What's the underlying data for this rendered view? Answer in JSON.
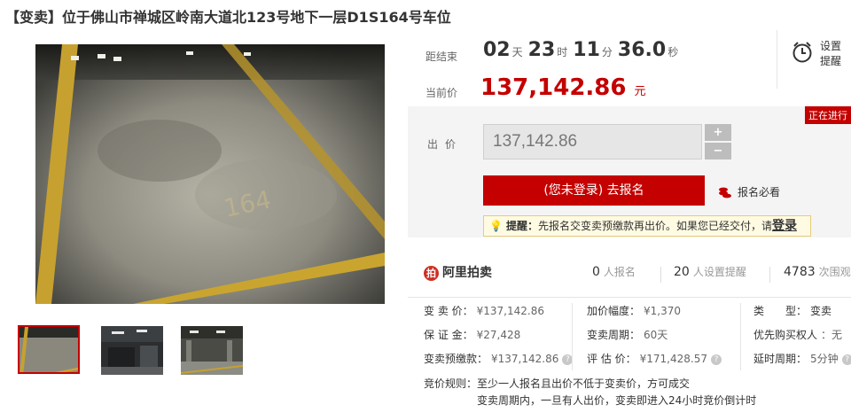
{
  "title": "【变卖】位于佛山市禅城区岭南大道北123号地下一层D1S164号车位",
  "countdown": {
    "label": "距结束",
    "days": "02",
    "days_unit": "天",
    "hours": "23",
    "hours_unit": "时",
    "minutes": "11",
    "minutes_unit": "分",
    "seconds": "36.0",
    "seconds_unit": "秒"
  },
  "reminder": {
    "label": "设置提醒"
  },
  "current_price": {
    "label": "当前价",
    "value": "137,142.86",
    "unit": "元"
  },
  "status_tag": "正在进行",
  "bid": {
    "label": "出价",
    "input_value": "137,142.86",
    "plus": "+",
    "minus": "−",
    "signup_button": "(您未登录) 去报名",
    "must_read": "报名必看"
  },
  "tip": {
    "prefix": "提醒：",
    "text": "先报名交变卖预缴款再出价。如果您已经交付，请",
    "login": "登录"
  },
  "stats": {
    "logo": "阿里拍卖",
    "signups_count": "0",
    "signups_label": "人报名",
    "reminders_count": "20",
    "reminders_label": "人设置提醒",
    "views_count": "4783",
    "views_label": "次围观"
  },
  "details": {
    "col1": [
      {
        "key": "变 卖 价：",
        "value": "¥137,142.86"
      },
      {
        "key": "保 证 金：",
        "value": "¥27,428"
      },
      {
        "key": "变卖预缴款：",
        "value": "¥137,142.86"
      }
    ],
    "col2": [
      {
        "key": "加价幅度：",
        "value": "¥1,370"
      },
      {
        "key": "变卖周期：",
        "value": "60天"
      },
      {
        "key": "评 估 价：",
        "value": "¥171,428.57"
      }
    ],
    "col3": [
      {
        "key": "类　　型：",
        "value": "变卖"
      },
      {
        "key": "优先购买权人",
        "value": "：无"
      },
      {
        "key": "延时周期：",
        "value": "5分钟"
      }
    ],
    "help_mark": "?"
  },
  "rules": {
    "label": "竞价规则：",
    "line1": "至少一人报名且出价不低于变卖价，方可成交",
    "line2": "变卖周期内，一旦有人出价，变卖即进入24小时竞价倒计时"
  },
  "colors": {
    "accent": "#c40000",
    "text": "#333333",
    "muted": "#999999"
  }
}
